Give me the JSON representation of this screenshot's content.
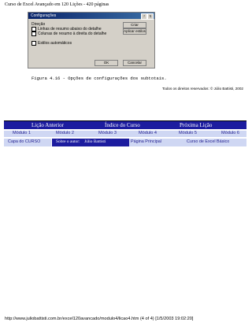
{
  "header": {
    "title": "Curso de Excel Avançado em 120 Lições - 420 páginas"
  },
  "dialog": {
    "title": "Configurações",
    "group_label": "Direção",
    "opt1": "Linhas de resumo abaixo do detalhe",
    "opt2": "Colunas de resumo à direita do detalhe",
    "opt3": "Estilos automáticos",
    "btn_create": "Criar",
    "btn_apply": "Aplicar estilos",
    "btn_ok": "OK",
    "btn_cancel": "Cancelar",
    "tb_help": "?",
    "tb_close": "X"
  },
  "caption": "Figura 4.16 - Opções de configurações dos subtotais.",
  "copyright": "Todos os direitos reservados: © Júlio Battisti, 2002",
  "nav": {
    "prev": "Lição Anterior",
    "index": "Índice do Curso",
    "next": "Próxima Lição"
  },
  "modules": [
    "Módulo 1",
    "Módulo 2",
    "Módulo 3",
    "Módulo 4",
    "Módulo 5",
    "Módulo 6"
  ],
  "bottom": {
    "capa": "Capa do CURSO",
    "sobre": "Sobre o autor:",
    "author": "Júlio Battisti",
    "home": "Página Principal",
    "basic": "Curso de Excel Básico"
  },
  "footer": "http://www.juliobattisti.com.br/excel120avancado/modulo4/licao4.htm (4 of 4) [1/5/2003 19:02:20]"
}
